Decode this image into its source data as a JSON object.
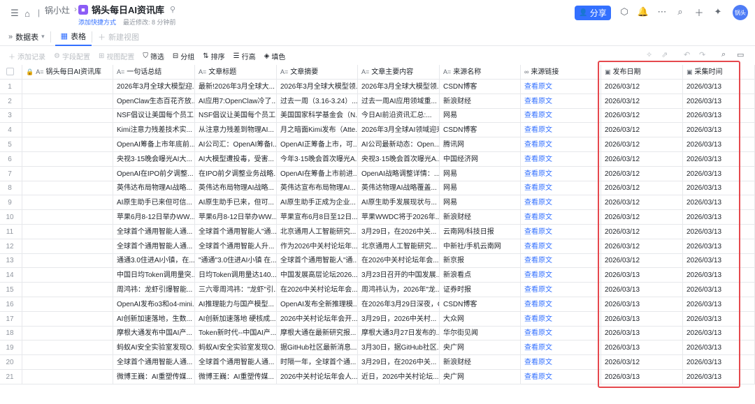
{
  "header": {
    "breadcrumb_parent": "锅小灶",
    "doc_title": "锅头每日AI资讯库",
    "doc_logo": "■",
    "add_shortcut": "添加快捷方式",
    "last_modified": "最近修改: 8 分钟前",
    "share_label": "分享",
    "avatar_label": "锅头"
  },
  "tabs": {
    "data_table": "数据表",
    "table_view": "表格",
    "new_view": "新建视图"
  },
  "toolbar": {
    "add_record": "添加记录",
    "field_config": "字段配置",
    "view_config": "视图配置",
    "filter": "筛选",
    "group": "分组",
    "sort": "排序",
    "row_height": "行高",
    "fill_color": "填色"
  },
  "table": {
    "columns": [
      {
        "label": "锅头每日AI资讯库",
        "icon": "A="
      },
      {
        "label": "一句话总结",
        "icon": "A="
      },
      {
        "label": "文章标题",
        "icon": "A="
      },
      {
        "label": "文章摘要",
        "icon": "A="
      },
      {
        "label": "文章主要内容",
        "icon": "A="
      },
      {
        "label": "来源名称",
        "icon": "A="
      },
      {
        "label": "来源链接",
        "icon": "∞"
      },
      {
        "label": "发布日期",
        "icon": "▣"
      },
      {
        "label": "采集时间",
        "icon": "▣"
      }
    ],
    "rows": [
      {
        "n": "1",
        "c1": "",
        "c2": "2026年3月全球大模型迎...",
        "c3": "最新!2026年3月全球大...",
        "c4": "2026年3月全球大模型领...",
        "c5": "2026年3月全球大模型领...",
        "c6": "CSDN博客",
        "c7": "查看原文",
        "c8": "2026/03/12",
        "c9": "2026/03/13"
      },
      {
        "n": "2",
        "c1": "",
        "c2": "OpenClaw生态百花齐放...",
        "c3": "AI应用7:OpenClaw冷了...",
        "c4": "过去一周（3.16-3.24）...",
        "c5": "过去一周AI应用领域重...",
        "c6": "新浪财经",
        "c7": "查看原文",
        "c8": "2026/03/12",
        "c9": "2026/03/13"
      },
      {
        "n": "3",
        "c1": "",
        "c2": "NSF倡议让美国每个员工...",
        "c3": "NSF倡议让美国每个员工...",
        "c4": "美国国家科学基金会（N...",
        "c5": "今日AI前沿资讯汇总:...",
        "c6": "网易",
        "c7": "查看原文",
        "c8": "2026/03/12",
        "c9": "2026/03/13"
      },
      {
        "n": "4",
        "c1": "",
        "c2": "Kimi注意力残差技术实...",
        "c3": "从注意力残差到物理AI...",
        "c4": "月之暗面Kimi发布（Atte...",
        "c5": "2026年3月全球AI领域迎来双...",
        "c6": "CSDN博客",
        "c7": "查看原文",
        "c8": "2026/03/12",
        "c9": "2026/03/13"
      },
      {
        "n": "5",
        "c1": "",
        "c2": "OpenAI筹备上市年底前...",
        "c3": "AI公司汇：OpenAI筹备I...",
        "c4": "OpenAI正筹备上市，可...",
        "c5": "AI公司最新动态：Open...",
        "c6": "腾讯网",
        "c7": "查看原文",
        "c8": "2026/03/12",
        "c9": "2026/03/13"
      },
      {
        "n": "6",
        "c1": "",
        "c2": "央视3·15晚会曝光AI大...",
        "c3": "AI大模型遭投毒，受害...",
        "c4": "今年3·15晚会首次曝光A...",
        "c5": "央视3·15晚会首次曝光A...",
        "c6": "中国经济网",
        "c7": "查看原文",
        "c8": "2026/03/12",
        "c9": "2026/03/13"
      },
      {
        "n": "7",
        "c1": "",
        "c2": "OpenAI在IPO前夕调整...",
        "c3": "在IPO前夕调整业务战略...",
        "c4": "OpenAI在筹备上市前进...",
        "c5": "OpenAI战略调整详情：...",
        "c6": "网易",
        "c7": "查看原文",
        "c8": "2026/03/12",
        "c9": "2026/03/13"
      },
      {
        "n": "8",
        "c1": "",
        "c2": "英伟达布局物理AI战略...",
        "c3": "英伟达布局物理AI战略...",
        "c4": "英伟达宣布布局物理AI...",
        "c5": "英伟达物理AI战略覆盖...",
        "c6": "网易",
        "c7": "查看原文",
        "c8": "2026/03/12",
        "c9": "2026/03/13"
      },
      {
        "n": "9",
        "c1": "",
        "c2": "AI原生助手已来但可信...",
        "c3": "AI原生助手已来，但可...",
        "c4": "AI原生助手正成为企业...",
        "c5": "AI原生助手发展现状与...",
        "c6": "网易",
        "c7": "查看原文",
        "c8": "2026/03/12",
        "c9": "2026/03/13"
      },
      {
        "n": "10",
        "c1": "",
        "c2": "苹果6月8-12日举办WW...",
        "c3": "苹果6月8-12日举办WW...",
        "c4": "苹果宣布6月8日至12日...",
        "c5": "苹果WWDC将于2026年...",
        "c6": "新浪财经",
        "c7": "查看原文",
        "c8": "2026/03/12",
        "c9": "2026/03/13"
      },
      {
        "n": "11",
        "c1": "",
        "c2": "全球首个通用智能人通...",
        "c3": "全球首个通用智能人\"通...",
        "c4": "北京通用人工智能研究...",
        "c5": "3月29日，在2026中关...",
        "c6": "云南网/科技日报",
        "c7": "查看原文",
        "c8": "2026/03/12",
        "c9": "2026/03/13"
      },
      {
        "n": "12",
        "c1": "",
        "c2": "全球首个通用智能人通...",
        "c3": "全球首个通用智能人升...",
        "c4": "作为2026中关村论坛年...",
        "c5": "北京通用人工智能研究...",
        "c6": "中新社/手机云南网",
        "c7": "查看原文",
        "c8": "2026/03/12",
        "c9": "2026/03/13"
      },
      {
        "n": "13",
        "c1": "",
        "c2": "通通3.0住进AI小镇，在...",
        "c3": "\"通通\"3.0住进AI小镇 在...",
        "c4": "全球首个通用智能人\"通...",
        "c5": "在2026中关村论坛年会...",
        "c6": "新京报",
        "c7": "查看原文",
        "c8": "2026/03/12",
        "c9": "2026/03/13"
      },
      {
        "n": "14",
        "c1": "",
        "c2": "中国日均Token调用量突...",
        "c3": "日均Token调用量达140...",
        "c4": "中国发展高层论坛2026...",
        "c5": "3月23日召开的中国发展...",
        "c6": "新浪看点",
        "c7": "查看原文",
        "c8": "2026/03/13",
        "c9": "2026/03/13"
      },
      {
        "n": "15",
        "c1": "",
        "c2": "周鸿祎：龙虾引爆智能...",
        "c3": "三六零周鸿祎：\"龙虾\"引...",
        "c4": "在2026中关村论坛年会...",
        "c5": "周鸿祎认为，2026年\"龙...",
        "c6": "证券时报",
        "c7": "查看原文",
        "c8": "2026/03/13",
        "c9": "2026/03/13"
      },
      {
        "n": "16",
        "c1": "",
        "c2": "OpenAI发布o3和o4-mini...",
        "c3": "AI推理能力与国产模型...",
        "c4": "OpenAI发布全新推理模...",
        "c5": "在2026年3月29日深夜，O...",
        "c6": "CSDN博客",
        "c7": "查看原文",
        "c8": "2026/03/13",
        "c9": "2026/03/13"
      },
      {
        "n": "17",
        "c1": "",
        "c2": "AI创新加速落地，生数...",
        "c3": "AI创新加速落地 硬核成...",
        "c4": "2026中关村论坛年会开...",
        "c5": "3月29日，2026中关村...",
        "c6": "大众网",
        "c7": "查看原文",
        "c8": "2026/03/13",
        "c9": "2026/03/13"
      },
      {
        "n": "18",
        "c1": "",
        "c2": "摩根大通发布中国AI产...",
        "c3": "Token新时代--中国AI产...",
        "c4": "摩根大通在最新研究报...",
        "c5": "摩根大通3月27日发布的...",
        "c6": "华尔街见闻",
        "c7": "查看原文",
        "c8": "2026/03/13",
        "c9": "2026/03/13"
      },
      {
        "n": "19",
        "c1": "",
        "c2": "蚂蚁AI安全实验室发现O...",
        "c3": "蚂蚁AI安全实验室发现O...",
        "c4": "据GitHub社区最新消息...",
        "c5": "3月30日，据GitHub社区...",
        "c6": "央广网",
        "c7": "查看原文",
        "c8": "2026/03/13",
        "c9": "2026/03/13"
      },
      {
        "n": "20",
        "c1": "",
        "c2": "全球首个通用智能人通...",
        "c3": "全球首个通用智能人通...",
        "c4": "时隔一年，全球首个通...",
        "c5": "3月29日，在2026中关...",
        "c6": "新浪财经",
        "c7": "查看原文",
        "c8": "2026/03/12",
        "c9": "2026/03/13"
      },
      {
        "n": "21",
        "c1": "",
        "c2": "微博王巍：AI重塑传媒...",
        "c3": "微博王巍：AI重塑传媒...",
        "c4": "2026中关村论坛年会人...",
        "c5": "近日，2026中关村论坛...",
        "c6": "央广网",
        "c7": "查看原文",
        "c8": "2026/03/13",
        "c9": "2026/03/13"
      }
    ]
  },
  "colors": {
    "accent": "#3370ff",
    "highlight_border": "#e5484d"
  }
}
